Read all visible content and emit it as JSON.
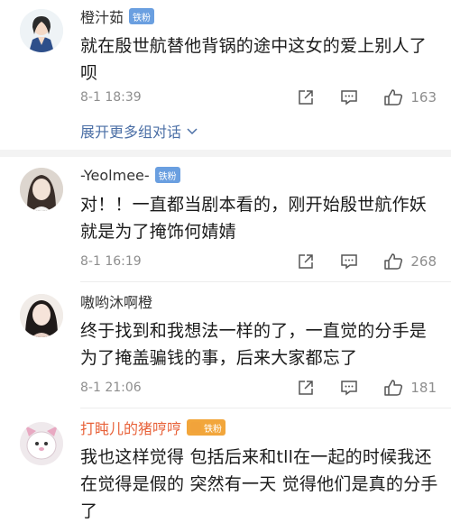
{
  "comments": [
    {
      "username": "橙汁茹",
      "badge": "铁粉",
      "text": "就在殷世航替他背锅的途中这女的爱上别人了呗",
      "timestamp": "8-1 18:39",
      "likes": "163",
      "expand_label": "展开更多组对话"
    },
    {
      "username": "-Yeolmee-",
      "badge": "铁粉",
      "text": "对！！一直都当剧本看的，刚开始殷世航作妖就是为了掩饰何婧婧",
      "timestamp": "8-1 16:19",
      "likes": "268"
    },
    {
      "username": "嗷哟沐啊橙",
      "text": "终于找到和我想法一样的了，一直觉的分手是为了掩盖骗钱的事，后来大家都忘了",
      "timestamp": "8-1 21:06",
      "likes": "181"
    },
    {
      "username": "打盹儿的猪哼哼",
      "badge": "铁粉",
      "text": "我也这样觉得 包括后来和tll在一起的时候我还在觉得是假的 突然有一天 觉得他们是真的分手了"
    }
  ],
  "colors": {
    "badge": "#6a9fe0",
    "vip_name": "#e8623a",
    "link": "#4b6fa6",
    "meta": "#8e8e8e"
  },
  "icons": [
    "share-icon",
    "comment-icon",
    "like-icon",
    "chevron-down-icon"
  ]
}
